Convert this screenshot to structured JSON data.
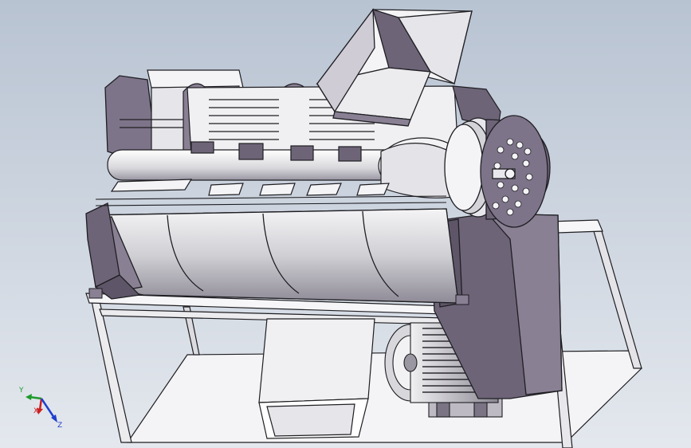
{
  "viewport": {
    "background_top": "#b8c3d2",
    "background_bottom": "#e4e8ee"
  },
  "model": {
    "shading_dark": "#6e6478",
    "shading_mid": "#9a92a4",
    "shading_light": "#e8e8ea",
    "frame_color": "#f2f2f4",
    "edge_color": "#1e1e22"
  },
  "triad": {
    "x_label": "X",
    "y_label": "Y",
    "z_label": "Z",
    "x_color": "#cc1f1f",
    "y_color": "#1f9a2a",
    "z_color": "#1f3fcc"
  }
}
